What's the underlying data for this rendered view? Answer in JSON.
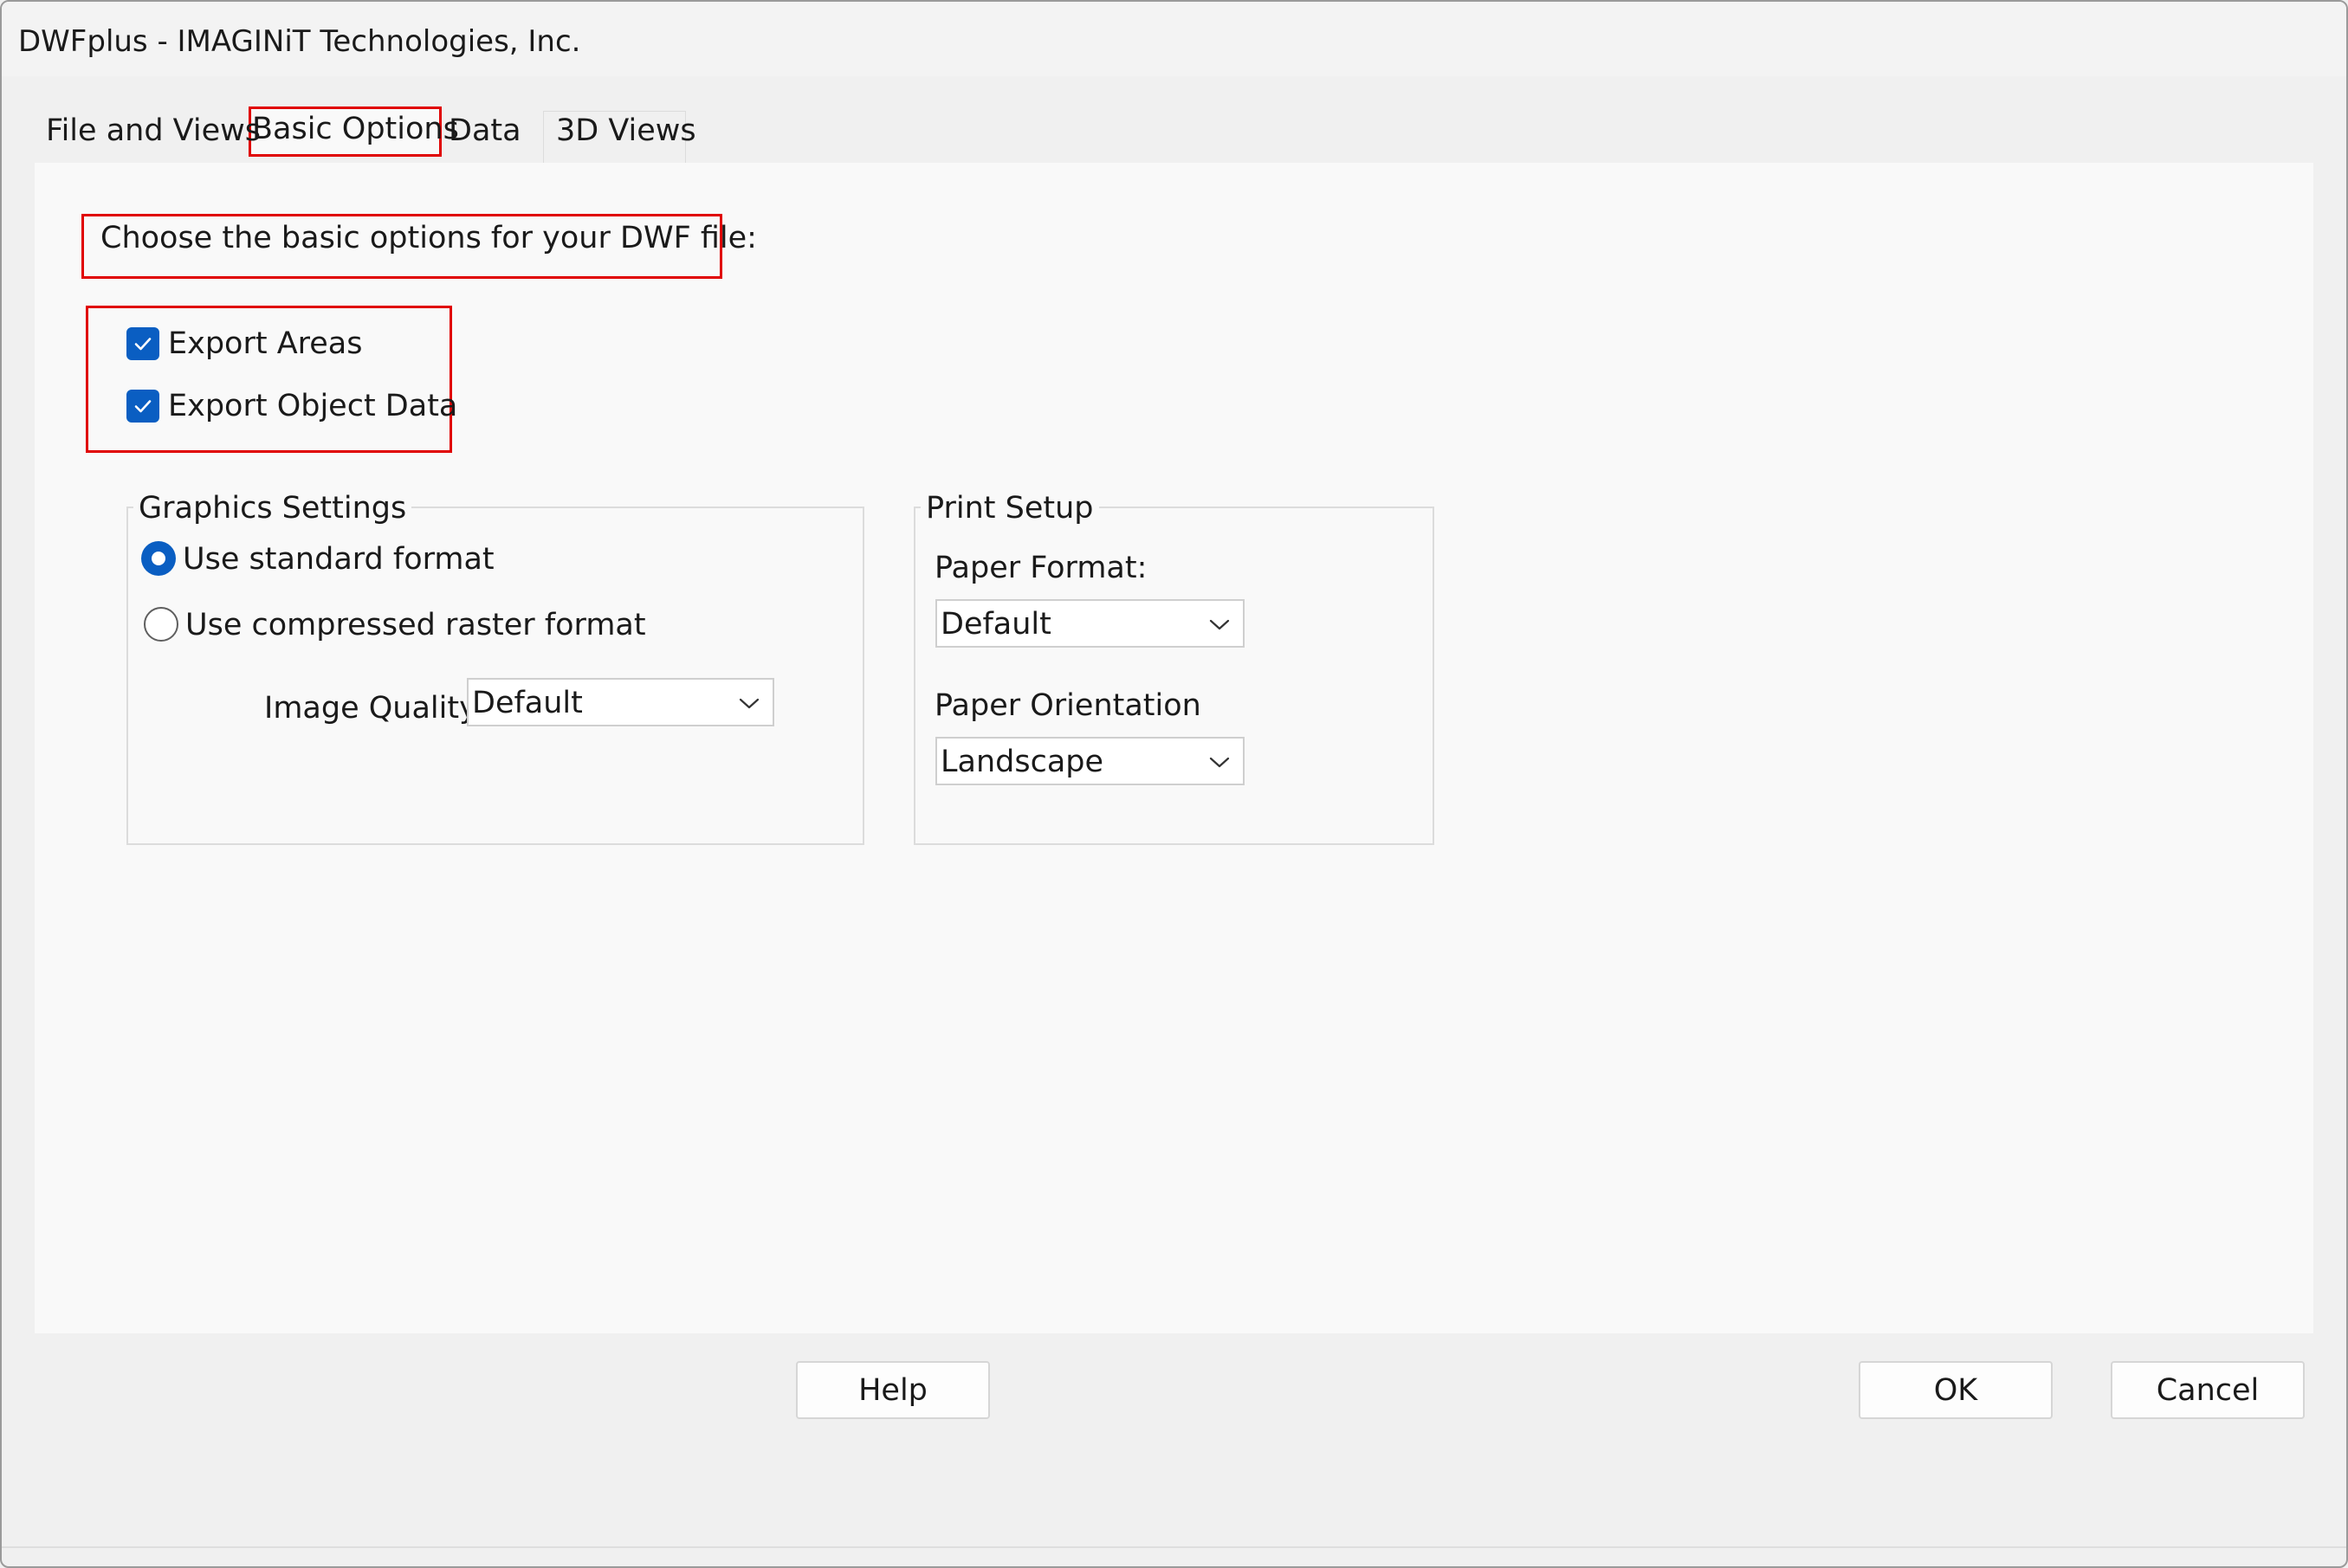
{
  "window": {
    "title": "DWFplus - IMAGINiT Technologies, Inc."
  },
  "tabs": [
    {
      "label": "File and Views",
      "active": false
    },
    {
      "label": "Basic Options",
      "active": true
    },
    {
      "label": "Data",
      "active": false
    },
    {
      "label": "3D Views",
      "active": false
    }
  ],
  "basic_options": {
    "instruction": "Choose the basic options for your DWF file:",
    "export_areas": {
      "label": "Export Areas",
      "checked": true
    },
    "export_object_data": {
      "label": "Export Object Data",
      "checked": true
    }
  },
  "graphics_settings": {
    "legend": "Graphics Settings",
    "standard_format": {
      "label": "Use standard format",
      "selected": true
    },
    "compressed_raster": {
      "label": "Use compressed raster format",
      "selected": false
    },
    "image_quality": {
      "label": "Image Quality:",
      "value": "Default"
    }
  },
  "print_setup": {
    "legend": "Print Setup",
    "paper_format": {
      "label": "Paper Format:",
      "value": "Default"
    },
    "paper_orientation": {
      "label": "Paper Orientation",
      "value": "Landscape"
    }
  },
  "buttons": {
    "help": "Help",
    "ok": "OK",
    "cancel": "Cancel"
  },
  "colors": {
    "accent": "#0a5ec2",
    "highlight_box": "#e00000",
    "panel_background": "#f9f9f9",
    "window_background": "#f0f0f0"
  },
  "icons": {
    "checkbox_checked": "checkmark-icon",
    "dropdown": "chevron-down-icon"
  }
}
